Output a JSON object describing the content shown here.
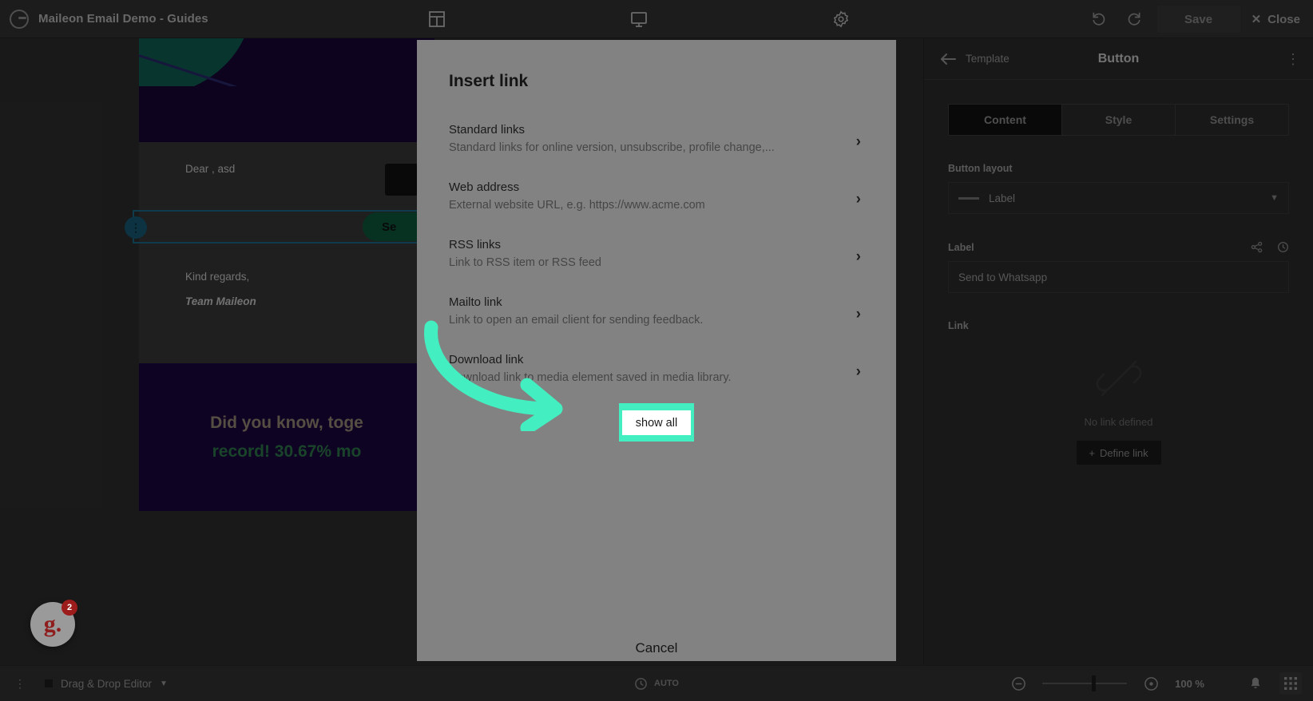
{
  "topbar": {
    "brand_title": "Maileon Email Demo - Guides",
    "icons": [
      {
        "name": "layout-grid-icon"
      },
      {
        "name": "desktop-preview-icon"
      },
      {
        "name": "settings-gear-icon"
      }
    ],
    "undo_label": "Undo",
    "redo_label": "Redo",
    "save_label": "Save",
    "close_label": "Close"
  },
  "canvas": {
    "greeting": "Dear , asd",
    "closing": "Kind regards,",
    "signature": "Team Maileon",
    "button_label": "Se",
    "banner_line1": "Did you know, toge",
    "banner_line2": "record! 30.67% mo"
  },
  "panel": {
    "back_label": "Template",
    "title": "Button",
    "tabs": [
      {
        "label": "Content",
        "active": true
      },
      {
        "label": "Style",
        "active": false
      },
      {
        "label": "Settings",
        "active": false
      }
    ],
    "button_layout_label": "Button layout",
    "button_layout_value": "Label",
    "label_field_label": "Label",
    "label_field_value": "Send to Whatsapp",
    "link_label": "Link",
    "no_link_text": "No link defined",
    "define_link_label": "Define link"
  },
  "modal": {
    "title": "Insert link",
    "items": [
      {
        "title": "Standard links",
        "subtitle": "Standard links for online version, unsubscribe, profile change,..."
      },
      {
        "title": "Web address",
        "subtitle": "External website URL, e.g. https://www.acme.com"
      },
      {
        "title": "RSS links",
        "subtitle": "Link to RSS item or RSS feed"
      },
      {
        "title": "Mailto link",
        "subtitle": "Link to open an email client for sending feedback."
      },
      {
        "title": "Download link",
        "subtitle": "Download link to media element saved in media library."
      }
    ],
    "show_all_label": "show all",
    "cancel_label": "Cancel"
  },
  "bottombar": {
    "editor_label": "Drag & Drop Editor",
    "auto_label": "AUTO",
    "zoom_value": "100 %"
  },
  "badge": {
    "logo_text": "g.",
    "count": "2"
  },
  "colors": {
    "annotation": "#43efc0",
    "modal_bg": "#828282",
    "panel_bg": "#2d2d2d",
    "accent_green": "#0d5c3e",
    "selection_blue": "#1d6e8c"
  }
}
